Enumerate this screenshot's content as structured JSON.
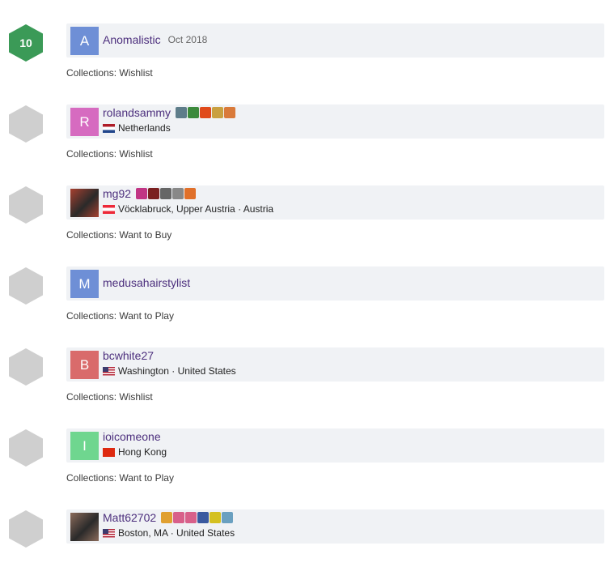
{
  "entries": [
    {
      "rating": "10",
      "rated": true,
      "avatar_letter": "A",
      "avatar_color": "#6e8fd6",
      "avatar_type": "letter",
      "username": "Anomalistic",
      "date": "Oct 2018",
      "location": "",
      "flag": "",
      "badges": [],
      "collections": "Collections: Wishlist"
    },
    {
      "rating": "",
      "rated": false,
      "avatar_letter": "R",
      "avatar_color": "#d66bc0",
      "avatar_type": "letter",
      "username": "rolandsammy",
      "date": "",
      "location": "Netherlands",
      "flag": "nl",
      "badges": [
        "#5e7d8a",
        "#3c8a3c",
        "#e04a1a",
        "#c9a040",
        "#d97a3a"
      ],
      "collections": "Collections: Wishlist"
    },
    {
      "rating": "",
      "rated": false,
      "avatar_letter": "",
      "avatar_color": "#a64030",
      "avatar_type": "photo",
      "username": "mg92",
      "date": "",
      "location": "Vöcklabruck, Upper Austria · Austria",
      "flag": "at",
      "badges": [
        "#c13584",
        "#7a2020",
        "#666666",
        "#888888",
        "#e0702a"
      ],
      "collections": "Collections: Want to Buy"
    },
    {
      "rating": "",
      "rated": false,
      "avatar_letter": "M",
      "avatar_color": "#6e8fd6",
      "avatar_type": "letter",
      "username": "medusahairstylist",
      "date": "",
      "location": "",
      "flag": "",
      "badges": [],
      "collections": "Collections: Want to Play"
    },
    {
      "rating": "",
      "rated": false,
      "avatar_letter": "B",
      "avatar_color": "#d96b6b",
      "avatar_type": "letter",
      "username": "bcwhite27",
      "date": "",
      "location": "Washington · United States",
      "flag": "us",
      "badges": [],
      "collections": "Collections: Wishlist"
    },
    {
      "rating": "",
      "rated": false,
      "avatar_letter": "I",
      "avatar_color": "#6fd68f",
      "avatar_type": "letter",
      "username": "ioicomeone",
      "date": "",
      "location": "Hong Kong",
      "flag": "hk",
      "badges": [],
      "collections": "Collections: Want to Play"
    },
    {
      "rating": "",
      "rated": false,
      "avatar_letter": "",
      "avatar_color": "#8a6a5a",
      "avatar_type": "photo",
      "username": "Matt62702",
      "date": "",
      "location": "Boston, MA · United States",
      "flag": "us",
      "badges": [
        "#e0a030",
        "#d8608a",
        "#d8608a",
        "#3a5aa0",
        "#d4c020",
        "#6aa0c0"
      ],
      "collections": ""
    }
  ]
}
